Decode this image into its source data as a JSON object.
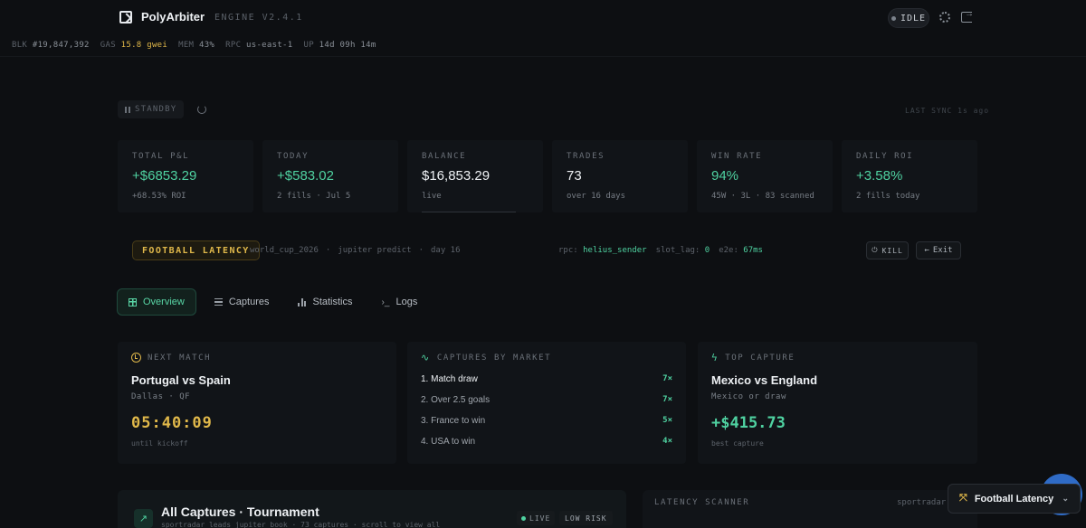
{
  "app": {
    "name": "PolyArbiter",
    "engine": "ENGINE V2.4.1",
    "status": "IDLE"
  },
  "metrics": {
    "blk_label": "BLK",
    "blk_value": "#19,847,392",
    "gas_label": "GAS",
    "gas_value": "15.8 gwei",
    "mem_label": "MEM",
    "mem_value": "43%",
    "rpc_label": "RPC",
    "rpc_value": "us-east-1",
    "up_label": "UP",
    "up_value": "14d 09h 14m"
  },
  "control": {
    "standby_label": "STANDBY",
    "last_sync": "LAST SYNC 1s ago"
  },
  "stats": [
    {
      "label": "TOTAL P&L",
      "value": "+$6853.29",
      "sub": "+68.53% ROI"
    },
    {
      "label": "TODAY",
      "value": "+$583.02",
      "sub": "2 fills · Jul 5"
    },
    {
      "label": "BALANCE",
      "value": "$16,853.29",
      "sub": "live"
    },
    {
      "label": "TRADES",
      "value": "73",
      "sub": "over 16 days"
    },
    {
      "label": "WIN RATE",
      "value": "94%",
      "sub": "45W · 3L · 83 scanned"
    },
    {
      "label": "DAILY ROI",
      "value": "+3.58%",
      "sub": "2 fills today"
    }
  ],
  "strategy": {
    "name": "FOOTBALL LATENCY",
    "event": "world_cup_2026",
    "model": "jupiter predict",
    "day": "day 16",
    "rpc_label": "rpc:",
    "rpc_value": "helius_sender",
    "slot_lag_label": "slot_lag:",
    "slot_lag_value": "0",
    "e2e_label": "e2e:",
    "e2e_value": "67ms",
    "kill_label": "KILL",
    "exit_label": "Exit"
  },
  "tabs": [
    {
      "label": "Overview"
    },
    {
      "label": "Captures"
    },
    {
      "label": "Statistics"
    },
    {
      "label": "Logs"
    }
  ],
  "next_match": {
    "title": "NEXT MATCH",
    "teams": "Portugal vs Spain",
    "venue": "Dallas · QF",
    "countdown": "05:40:09",
    "countdown_sub": "until kickoff"
  },
  "captures_by_market": {
    "title": "CAPTURES BY MARKET",
    "items": [
      {
        "label": "1. Match draw",
        "count": "7×"
      },
      {
        "label": "2. Over 2.5 goals",
        "count": "7×"
      },
      {
        "label": "3. France to win",
        "count": "5×"
      },
      {
        "label": "4. USA to win",
        "count": "4×"
      }
    ]
  },
  "top_capture": {
    "title": "TOP CAPTURE",
    "teams": "Mexico vs England",
    "market": "Mexico or draw",
    "profit": "+$415.73",
    "profit_sub": "best capture"
  },
  "all_captures": {
    "title": "All Captures · Tournament",
    "subtitle": "sportradar leads jupiter book · 73 captures · scroll to view all",
    "live_label": "LIVE",
    "risk_label": "LOW RISK"
  },
  "scanner": {
    "title": "LATENCY SCANNER",
    "source": "sportradar"
  },
  "strategy_selector": {
    "label": "Football Latency"
  },
  "colors": {
    "accent_green": "#4fd2a1",
    "accent_gold": "#e0b84a",
    "background": "#0d0f12",
    "fab_blue": "#2f6bc6"
  }
}
